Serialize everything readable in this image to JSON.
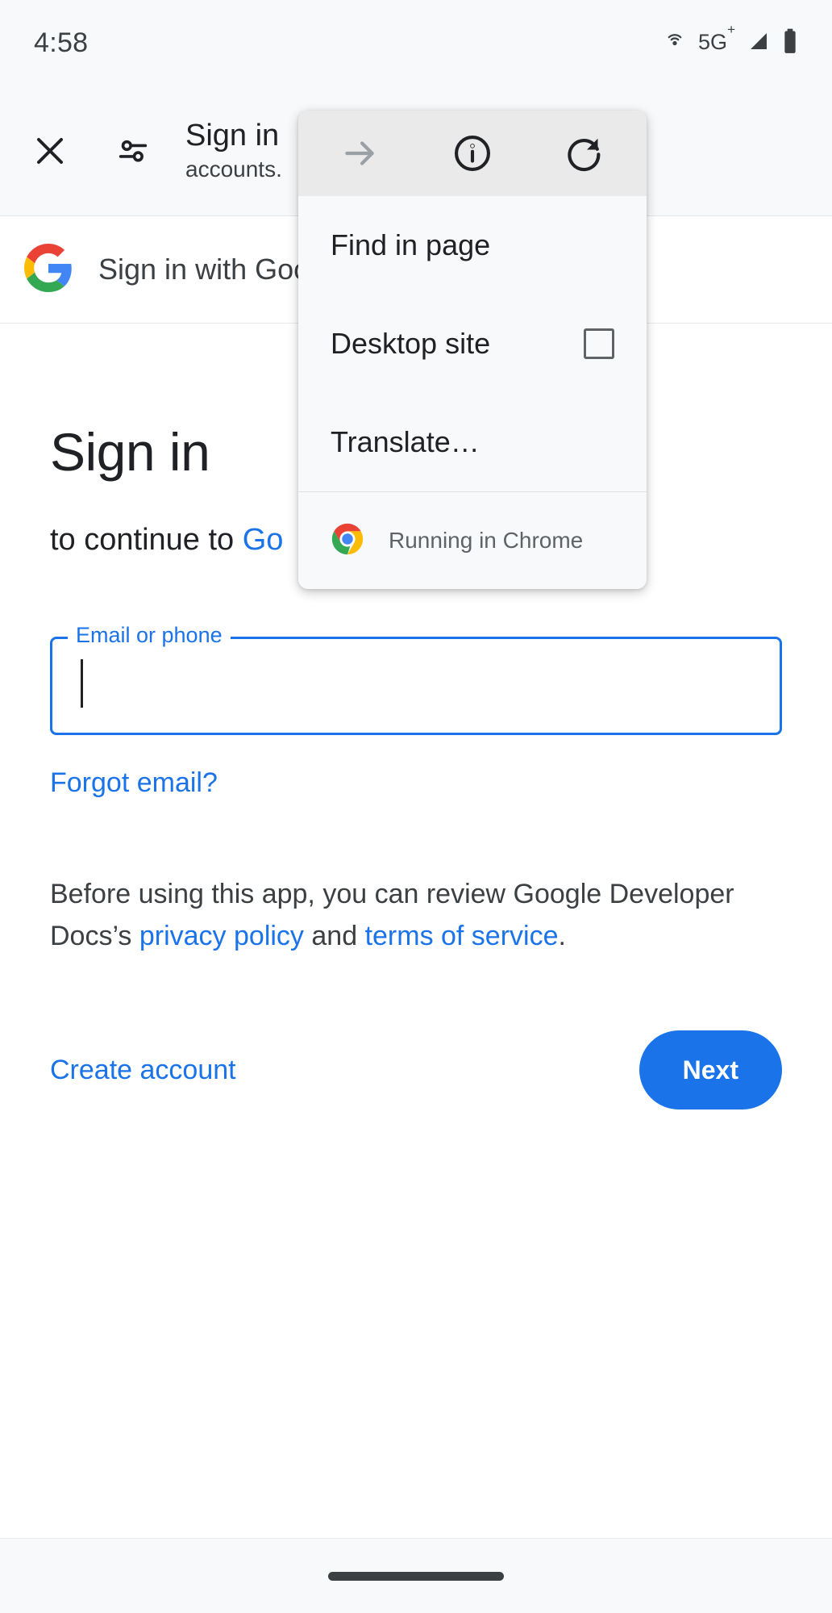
{
  "status_bar": {
    "time": "4:58",
    "network_label": "5G",
    "network_sup": "+",
    "icons": [
      "hotspot-icon",
      "signal-icon",
      "battery-icon"
    ]
  },
  "toolbar": {
    "close_icon": "close-icon",
    "page_info_icon": "tune-icon",
    "title": "Sign in",
    "subtitle": "accounts."
  },
  "menu": {
    "icon_row": [
      {
        "name": "forward-icon",
        "label": "Forward",
        "enabled": false
      },
      {
        "name": "info-icon",
        "label": "Page info",
        "enabled": true
      },
      {
        "name": "reload-icon",
        "label": "Reload",
        "enabled": true
      }
    ],
    "items": [
      {
        "label": "Find in page",
        "type": "action"
      },
      {
        "label": "Desktop site",
        "type": "checkbox",
        "checked": false
      },
      {
        "label": "Translate…",
        "type": "action"
      }
    ],
    "footer": {
      "icon": "chrome-logo-icon",
      "label": "Running in Chrome"
    }
  },
  "gsi_header": {
    "logo": "google-g-logo",
    "label": "Sign in with Goo"
  },
  "signin": {
    "heading": "Sign in",
    "subtitle_prefix": "to continue to ",
    "subtitle_link": "Go",
    "email_label": "Email or phone",
    "email_value": "",
    "email_placeholder": "",
    "forgot_email": "Forgot email?",
    "policy_prefix": "Before using this app, you can review Google Developer Docs’s ",
    "policy_link_1": "privacy policy",
    "policy_middle": " and ",
    "policy_link_2": "terms of service",
    "policy_suffix": ".",
    "create_account": "Create account",
    "next_button": "Next"
  },
  "colors": {
    "accent_blue": "#1a73e8",
    "text_primary": "#202124",
    "text_secondary": "#3c4043",
    "surface": "#f8f9fa",
    "menu_header": "#eaeaea"
  },
  "nav_bar": {
    "handle": "home-gesture-handle"
  }
}
